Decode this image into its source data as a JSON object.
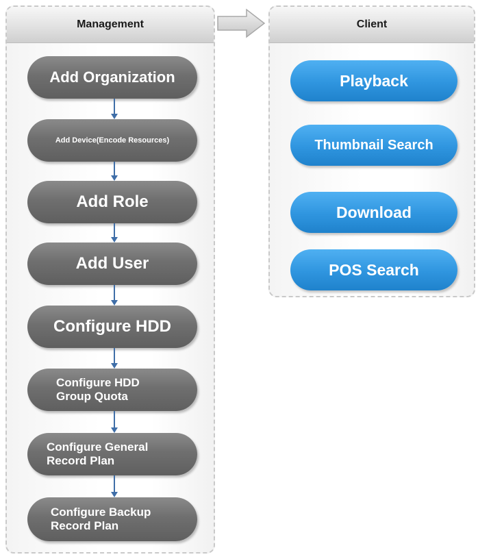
{
  "management": {
    "title": "Management",
    "steps": [
      "Add Organization",
      "Add Device(Encode Resources)",
      "Add Role",
      "Add User",
      "Configure HDD",
      "Configure HDD\nGroup Quota",
      "Configure General\nRecord Plan",
      "Configure Backup\nRecord Plan"
    ]
  },
  "client": {
    "title": "Client",
    "buttons": [
      "Playback",
      "Thumbnail Search",
      "Download",
      "POS Search"
    ]
  },
  "colors": {
    "step_gray": "#6f6f6f",
    "client_blue": "#2f95df",
    "connector_blue": "#3f6ea8"
  },
  "icons": {
    "panel_connector": "right-arrow-icon"
  }
}
